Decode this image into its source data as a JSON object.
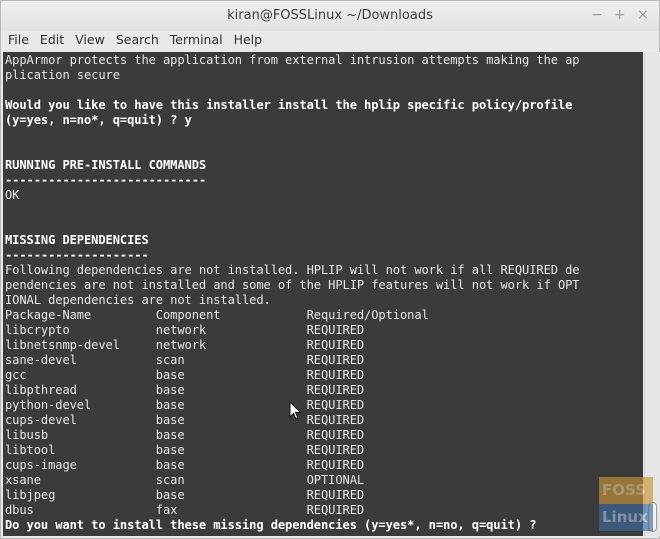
{
  "window": {
    "title": "kiran@FOSSLinux ~/Downloads",
    "controls": {
      "minimize": "−",
      "maximize": "+",
      "close": "×"
    }
  },
  "menubar": {
    "items": [
      "File",
      "Edit",
      "View",
      "Search",
      "Terminal",
      "Help"
    ]
  },
  "terminal": {
    "lines": [
      {
        "text": "AppArmor protects the application from external intrusion attempts making the ap",
        "bold": false
      },
      {
        "text": "plication secure",
        "bold": false
      },
      {
        "text": "",
        "bold": false
      },
      {
        "text": "Would you like to have this installer install the hplip specific policy/profile",
        "bold": true
      },
      {
        "text": "(y=yes, n=no*, q=quit) ? y",
        "bold": true
      },
      {
        "text": "",
        "bold": false
      },
      {
        "text": "",
        "bold": false
      },
      {
        "text": "RUNNING PRE-INSTALL COMMANDS",
        "bold": true
      },
      {
        "text": "----------------------------",
        "bold": true
      },
      {
        "text": "OK",
        "bold": false
      },
      {
        "text": "",
        "bold": false
      },
      {
        "text": "",
        "bold": false
      },
      {
        "text": "MISSING DEPENDENCIES",
        "bold": true
      },
      {
        "text": "--------------------",
        "bold": true
      },
      {
        "text": "Following dependencies are not installed. HPLIP will not work if all REQUIRED de",
        "bold": false
      },
      {
        "text": "pendencies are not installed and some of the HPLIP features will not work if OPT",
        "bold": false
      },
      {
        "text": "IONAL dependencies are not installed.",
        "bold": false
      },
      {
        "text": "Package-Name         Component            Required/Optional",
        "bold": false
      },
      {
        "text": "libcrypto            network              REQUIRED",
        "bold": false
      },
      {
        "text": "libnetsnmp-devel     network              REQUIRED",
        "bold": false
      },
      {
        "text": "sane-devel           scan                 REQUIRED",
        "bold": false
      },
      {
        "text": "gcc                  base                 REQUIRED",
        "bold": false
      },
      {
        "text": "libpthread           base                 REQUIRED",
        "bold": false
      },
      {
        "text": "python-devel         base                 REQUIRED",
        "bold": false
      },
      {
        "text": "cups-devel           base                 REQUIRED",
        "bold": false
      },
      {
        "text": "libusb               base                 REQUIRED",
        "bold": false
      },
      {
        "text": "libtool              base                 REQUIRED",
        "bold": false
      },
      {
        "text": "cups-image           base                 REQUIRED",
        "bold": false
      },
      {
        "text": "xsane                scan                 OPTIONAL",
        "bold": false
      },
      {
        "text": "libjpeg              base                 REQUIRED",
        "bold": false
      },
      {
        "text": "dbus                 fax                  REQUIRED",
        "bold": false
      },
      {
        "text": "Do you want to install these missing dependencies (y=yes*, n=no, q=quit) ?",
        "bold": true
      }
    ]
  },
  "watermark": {
    "top": "FOSS",
    "bottom": "Linux"
  },
  "colors": {
    "terminal_bg": "#3b3b3b",
    "terminal_fg": "#e8e8e8",
    "watermark_orange": "#c8953a",
    "watermark_blue": "#3f6a9c"
  }
}
